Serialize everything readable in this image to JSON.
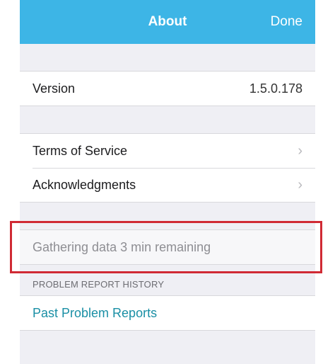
{
  "nav": {
    "title": "About",
    "done_label": "Done"
  },
  "version": {
    "label": "Version",
    "value": "1.5.0.178"
  },
  "links": [
    {
      "label": "Terms of Service"
    },
    {
      "label": "Acknowledgments"
    }
  ],
  "status": {
    "text": "Gathering data 3 min remaining"
  },
  "history": {
    "header": "PROBLEM REPORT HISTORY",
    "item_label": "Past Problem Reports"
  },
  "icons": {
    "disclosure": "chevron-right-icon"
  },
  "colors": {
    "nav_bg": "#3db5e6",
    "link": "#1a8fa5",
    "highlight": "#d02a34"
  }
}
